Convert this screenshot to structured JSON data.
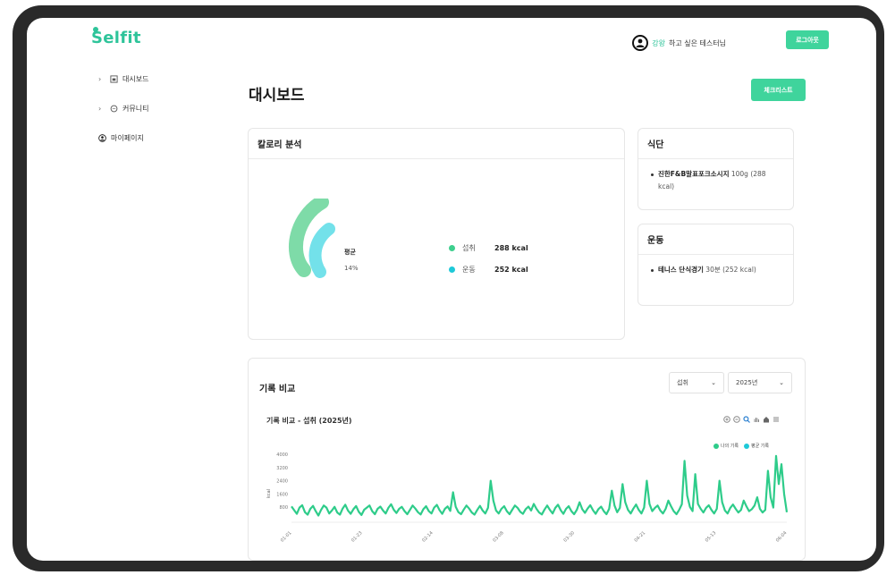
{
  "header": {
    "logo": "Selfit",
    "user_highlight": "강왕",
    "user_rest": "하고 싶은 테스터님",
    "logout_label": "로그아웃"
  },
  "sidebar": {
    "items": [
      {
        "label": "대시보드",
        "icon": "dashboard-icon",
        "has_chevron": true
      },
      {
        "label": "커뮤니티",
        "icon": "chat-icon",
        "has_chevron": true
      },
      {
        "label": "마이페이지",
        "icon": "user-icon",
        "has_chevron": false
      }
    ]
  },
  "page": {
    "title": "대시보드",
    "checklist_label": "체크리스트"
  },
  "calorie": {
    "title": "칼로리 분석",
    "avg_label": "평균",
    "avg_value": "14%",
    "intake_ratio": 0.53,
    "exercise_ratio": 0.47,
    "rows": [
      {
        "label": "섭취",
        "value": "288 kcal",
        "color": "#3ecf8e"
      },
      {
        "label": "운동",
        "value": "252 kcal",
        "color": "#1ec9d8"
      }
    ]
  },
  "diet": {
    "title": "식단",
    "item_name": "진한F&B말표포크소시지",
    "item_detail": " 100g (288 kcal)"
  },
  "exercise": {
    "title": "운동",
    "item_name": "테니스 단식경기",
    "item_detail": " 30분 (252 kcal)"
  },
  "compare": {
    "title": "기록 비교",
    "select_type": "섭취",
    "select_year": "2025년",
    "chart_title": "기록 비교 - 섭취 (2025년)",
    "legend_mine": "나의 기록",
    "legend_avg": "평균 기록",
    "ylabel": "kcal"
  },
  "chart_data": {
    "type": "line",
    "title": "기록 비교 - 섭취 (2025년)",
    "ylabel": "kcal",
    "yticks": [
      800,
      1600,
      2400,
      3200,
      4000
    ],
    "ylim": [
      0,
      4000
    ],
    "xticks": [
      "01-01",
      "01-23",
      "02-14",
      "03-08",
      "03-30",
      "04-21",
      "05-13",
      "06-04"
    ],
    "colors": {
      "mine": "#2ecc8a",
      "avg": "#1ec9d8"
    },
    "series": [
      {
        "name": "나의 기록",
        "values": [
          850,
          620,
          400,
          780,
          920,
          500,
          350,
          700,
          880,
          560,
          300,
          640,
          900,
          780,
          420,
          600,
          820,
          480,
          350,
          720,
          950,
          600,
          400,
          680,
          870,
          520,
          330,
          650,
          780,
          900,
          560,
          380,
          700,
          840,
          600,
          420,
          760,
          980,
          650,
          450,
          700,
          820,
          560,
          380,
          640,
          900,
          720,
          500,
          360,
          680,
          860,
          560,
          420,
          780,
          940,
          620,
          400,
          700,
          850,
          580,
          1700,
          820,
          500,
          380,
          660,
          900,
          720,
          480,
          350,
          640,
          880,
          600,
          420,
          760,
          2400,
          1200,
          600,
          420,
          700,
          860,
          560,
          380,
          650,
          900,
          760,
          520,
          400,
          680,
          840,
          600,
          1000,
          700,
          480,
          360,
          660,
          900,
          640,
          420,
          760,
          950,
          620,
          400,
          700,
          860,
          560,
          380,
          650,
          1100,
          680,
          460,
          720,
          920,
          620,
          400,
          680,
          840,
          560,
          380,
          700,
          1800,
          900,
          500,
          760,
          2200,
          1100,
          640,
          420,
          720,
          960,
          640,
          420,
          780,
          2400,
          1000,
          560,
          760,
          900,
          600,
          420,
          700,
          1200,
          860,
          560,
          380,
          640,
          980,
          3600,
          1500,
          820,
          560,
          2800,
          1000,
          700,
          480,
          760,
          920,
          640,
          420,
          700,
          2400,
          1100,
          600,
          420,
          760,
          960,
          700,
          480,
          640,
          1200,
          860,
          560,
          680,
          900,
          1400,
          700,
          480,
          640,
          3000,
          1400,
          780,
          3900,
          2200,
          3400,
          1600,
          500
        ]
      }
    ]
  }
}
